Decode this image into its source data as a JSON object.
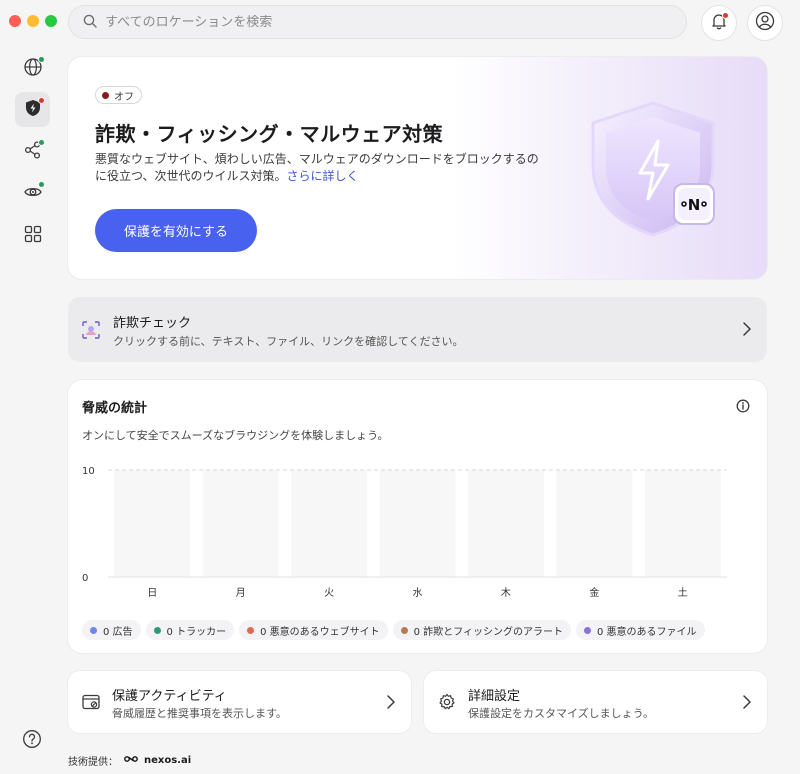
{
  "search": {
    "placeholder": "すべてのロケーションを検索"
  },
  "hero": {
    "badge": "オフ",
    "title": "詐欺・フィッシング・マルウェア対策",
    "description": "悪質なウェブサイト、煩わしい広告、マルウェアのダウンロードをブロックするのに役立つ、次世代のウイルス対策。",
    "learn_more": "さらに詳しく",
    "cta_label": "保護を有効にする"
  },
  "scam_check": {
    "title": "詐欺チェック",
    "subtitle": "クリックする前に、テキスト、ファイル、リンクを確認してください。"
  },
  "stats": {
    "title": "脅威の統計",
    "subtitle": "オンにして安全でスムーズなブラウジングを体験しましょう。",
    "legend": [
      {
        "label": "0 広告",
        "color": "#6f86e6"
      },
      {
        "label": "0 トラッカー",
        "color": "#2f9a75"
      },
      {
        "label": "0 悪意のあるウェブサイト",
        "color": "#dd6a55"
      },
      {
        "label": "0 詐欺とフィッシングのアラート",
        "color": "#b77a55"
      },
      {
        "label": "0 悪意のあるファイル",
        "color": "#8b73d1"
      }
    ]
  },
  "chart_data": {
    "type": "bar",
    "categories": [
      "日",
      "月",
      "火",
      "水",
      "木",
      "金",
      "土"
    ],
    "series": [
      {
        "values": [
          0,
          0,
          0,
          0,
          0,
          0,
          0
        ]
      }
    ],
    "ylim": [
      0,
      10
    ],
    "yticks": [
      "0",
      "10"
    ],
    "grid": true,
    "colors": {
      "grid": "#d9d9dc",
      "axis": "#e2e2e5",
      "bar_bg": "#f7f7f8"
    }
  },
  "activity": {
    "title": "保護アクティビティ",
    "subtitle": "脅威履歴と推奨事項を表示します。"
  },
  "settings": {
    "title": "詳細設定",
    "subtitle": "保護設定をカスタマイズしましょう。"
  },
  "footer": {
    "powered_by": "技術提供：",
    "brand": "nexos.ai"
  }
}
